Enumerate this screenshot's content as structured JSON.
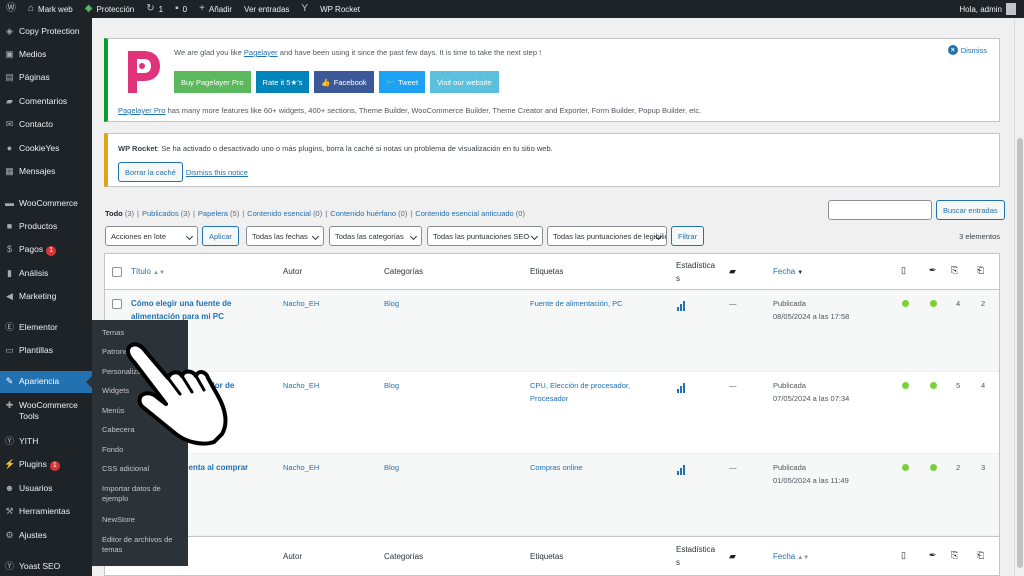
{
  "adminbar": {
    "site_name": "Mark web",
    "protection": "Protección",
    "updates": "1",
    "comments": "0",
    "add_new": "Añadir",
    "view_posts": "Ver entradas",
    "wp_rocket": "WP Rocket",
    "greeting": "Hola, admin"
  },
  "sidebar": {
    "items": [
      {
        "label": "Copy Protection",
        "icon": "shield-icon"
      },
      {
        "label": "Medios",
        "icon": "media-icon"
      },
      {
        "label": "Páginas",
        "icon": "page-icon"
      },
      {
        "label": "Comentarios",
        "icon": "comment-icon"
      },
      {
        "label": "Contacto",
        "icon": "mail-icon"
      },
      {
        "label": "CookieYes",
        "icon": "cookie-icon"
      },
      {
        "label": "Mensajes",
        "icon": "messages-icon"
      },
      {
        "label": "WooCommerce",
        "icon": "woo-icon"
      },
      {
        "label": "Productos",
        "icon": "box-icon"
      },
      {
        "label": "Pagos",
        "icon": "money-icon",
        "count": "1"
      },
      {
        "label": "Análisis",
        "icon": "chart-icon"
      },
      {
        "label": "Marketing",
        "icon": "megaphone-icon"
      },
      {
        "label": "Elementor",
        "icon": "elementor-icon"
      },
      {
        "label": "Plantillas",
        "icon": "folder-icon"
      },
      {
        "label": "Apariencia",
        "icon": "brush-icon"
      },
      {
        "label": "WooCommerce Tools",
        "icon": "tools-icon"
      },
      {
        "label": "YITH",
        "icon": "yith-icon"
      },
      {
        "label": "Plugins",
        "icon": "plug-icon",
        "count": "1"
      },
      {
        "label": "Usuarios",
        "icon": "user-icon"
      },
      {
        "label": "Herramientas",
        "icon": "wrench-icon"
      },
      {
        "label": "Ajustes",
        "icon": "settings-icon"
      },
      {
        "label": "Yoast SEO",
        "icon": "yoast-icon"
      }
    ]
  },
  "submenu": {
    "items": [
      "Temas",
      "Patrones",
      "Personalizar",
      "Widgets",
      "Menús",
      "Cabecera",
      "Fondo",
      "CSS adicional",
      "Importar datos de ejemplo",
      "NewStore",
      "Editor de archivos de temas"
    ]
  },
  "pagelayer_notice": {
    "text_before": "We are glad you like ",
    "link": "Pagelayer",
    "text_after": " and have been using it since the past few days. It is time to take the next step !",
    "buttons": [
      "Buy Pagelayer Pro",
      "Rate it 5★'s",
      "Facebook",
      "Tweet",
      "Visit our website"
    ],
    "desc_link": "Pagelayer Pro",
    "desc": " has many more features like 60+ widgets, 400+ sections, Theme Builder, WooCommerce Builder, Theme Creator and Exporter, Form Builder, Popup Builder, etc.",
    "dismiss": "Dismiss",
    "colors": {
      "green": "#5cb85c",
      "blue": "#0085ba",
      "facebook": "#3b5998",
      "twitter": "#1da1f2",
      "website": "#5bc0de",
      "logo": "#e0337a"
    }
  },
  "rocket_notice": {
    "bold": "WP Rocket",
    "text": ": Se ha activado o desactivado uno o más plugins, borra la caché si notas un problema de visualización en tu sitio web.",
    "button": "Borrar la caché",
    "dismiss": "Dismiss this notice"
  },
  "views": {
    "all": "Todo",
    "all_count": "(3)",
    "items": [
      {
        "label": "Publicados",
        "count": "(3)"
      },
      {
        "label": "Papelera",
        "count": "(5)"
      },
      {
        "label": "Contenido esencial",
        "count": "(0)"
      },
      {
        "label": "Contenido huérfano",
        "count": "(0)"
      },
      {
        "label": "Contenido esencial anticuado",
        "count": "(0)"
      }
    ]
  },
  "search": {
    "button": "Buscar entradas"
  },
  "tablenav": {
    "bulk": "Acciones en lote",
    "apply": "Aplicar",
    "dates": "Todas las fechas",
    "categories": "Todas las categorías",
    "scores1": "Todas las puntuaciones SEO",
    "scores2": "Todas las puntuaciones de legibilidad",
    "filter": "Filtrar",
    "items": "3 elementos"
  },
  "table": {
    "headers": {
      "title": "Título",
      "author": "Autor",
      "categories": "Categorías",
      "tags": "Etiquetas",
      "stats": "Estadística s",
      "date": "Fecha"
    },
    "rows": [
      {
        "title": "Cómo elegir una fuente de alimentación para mi PC",
        "author": "Nacho_EH",
        "category": "Blog",
        "tags": "Fuente de alimentación, PC",
        "dash": "—",
        "status": "Publicada",
        "date": "08/05/2024 a las 17:58",
        "links_in": "4",
        "links_out": "2"
      },
      {
        "title": "… procesador de",
        "author": "Nacho_EH",
        "category": "Blog",
        "tags": "CPU, Elección de procesador, Procesador",
        "dash": "—",
        "status": "Publicada",
        "date": "07/05/2024 a las 07:34",
        "links_in": "5",
        "links_out": "4"
      },
      {
        "title": "… cuenta al comprar",
        "author": "Nacho_EH",
        "category": "Blog",
        "tags": "Compras online",
        "dash": "—",
        "status": "Publicada",
        "date": "01/05/2024 a las 11:49",
        "links_in": "2",
        "links_out": "3"
      }
    ]
  }
}
